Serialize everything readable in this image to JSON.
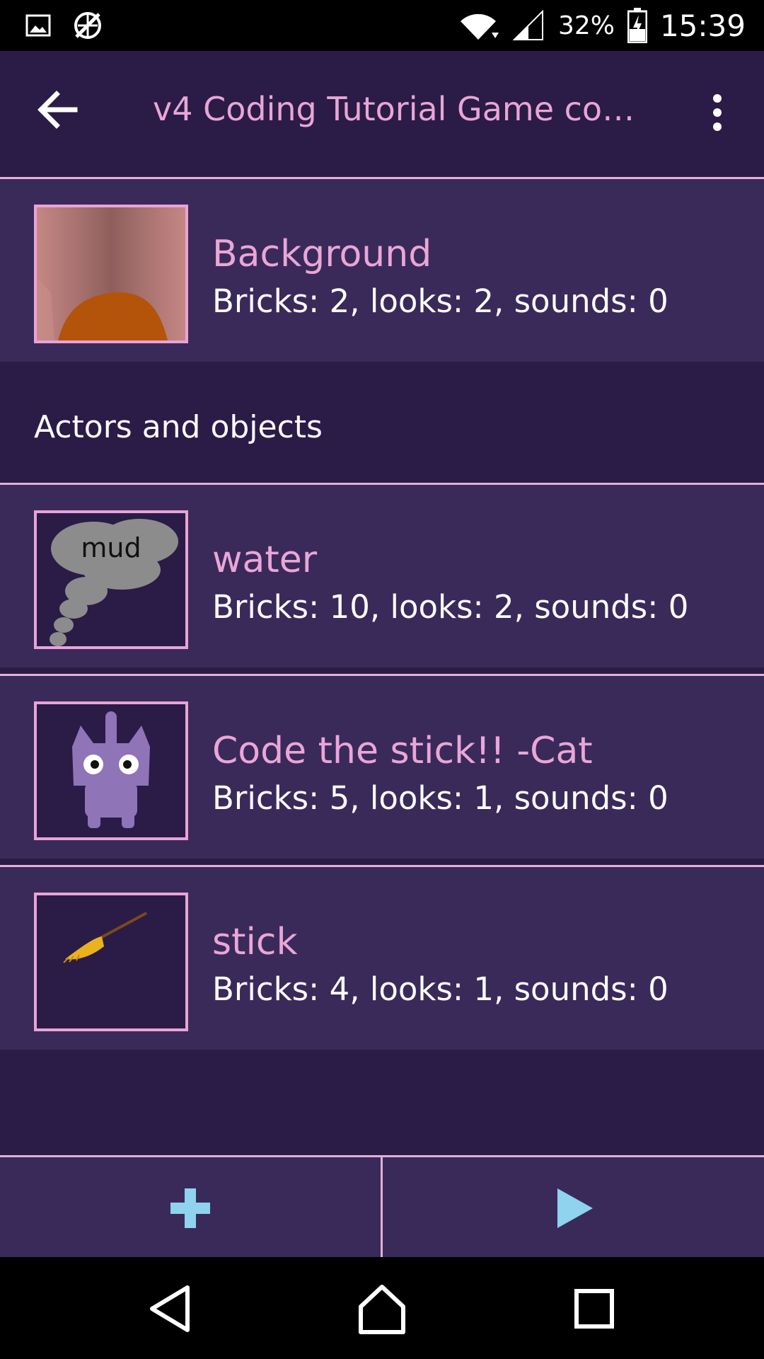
{
  "status_bar": {
    "battery": "32%",
    "time": "15:39",
    "icons": [
      "image-icon",
      "sync-disabled-icon",
      "wifi-icon",
      "cell-signal-icon",
      "battery-charging-icon"
    ]
  },
  "toolbar": {
    "title": "v4 Coding Tutorial Game copy (…",
    "back_icon": "arrow-left-icon",
    "menu_icon": "more-vert-icon"
  },
  "background": {
    "name": "Background",
    "info": "Bricks: 2, looks: 2, sounds: 0"
  },
  "section": {
    "title": "Actors and objects"
  },
  "objects": [
    {
      "name": "water",
      "info": "Bricks: 10, looks: 2, sounds: 0",
      "thumb_text": "mud"
    },
    {
      "name": "Code the stick!! -Cat",
      "info": "Bricks: 5, looks: 1, sounds: 0"
    },
    {
      "name": "stick",
      "info": "Bricks: 4, looks: 1, sounds: 0"
    }
  ],
  "actions": {
    "add_icon": "plus-icon",
    "play_icon": "play-icon"
  },
  "nav": {
    "icons": [
      "nav-back-icon",
      "nav-home-icon",
      "nav-recents-icon"
    ]
  },
  "colors": {
    "bg": "#2b1b47",
    "row": "#3a2a5a",
    "accent_pink": "#eaa6d8",
    "action_blue": "#8fd3ef"
  }
}
